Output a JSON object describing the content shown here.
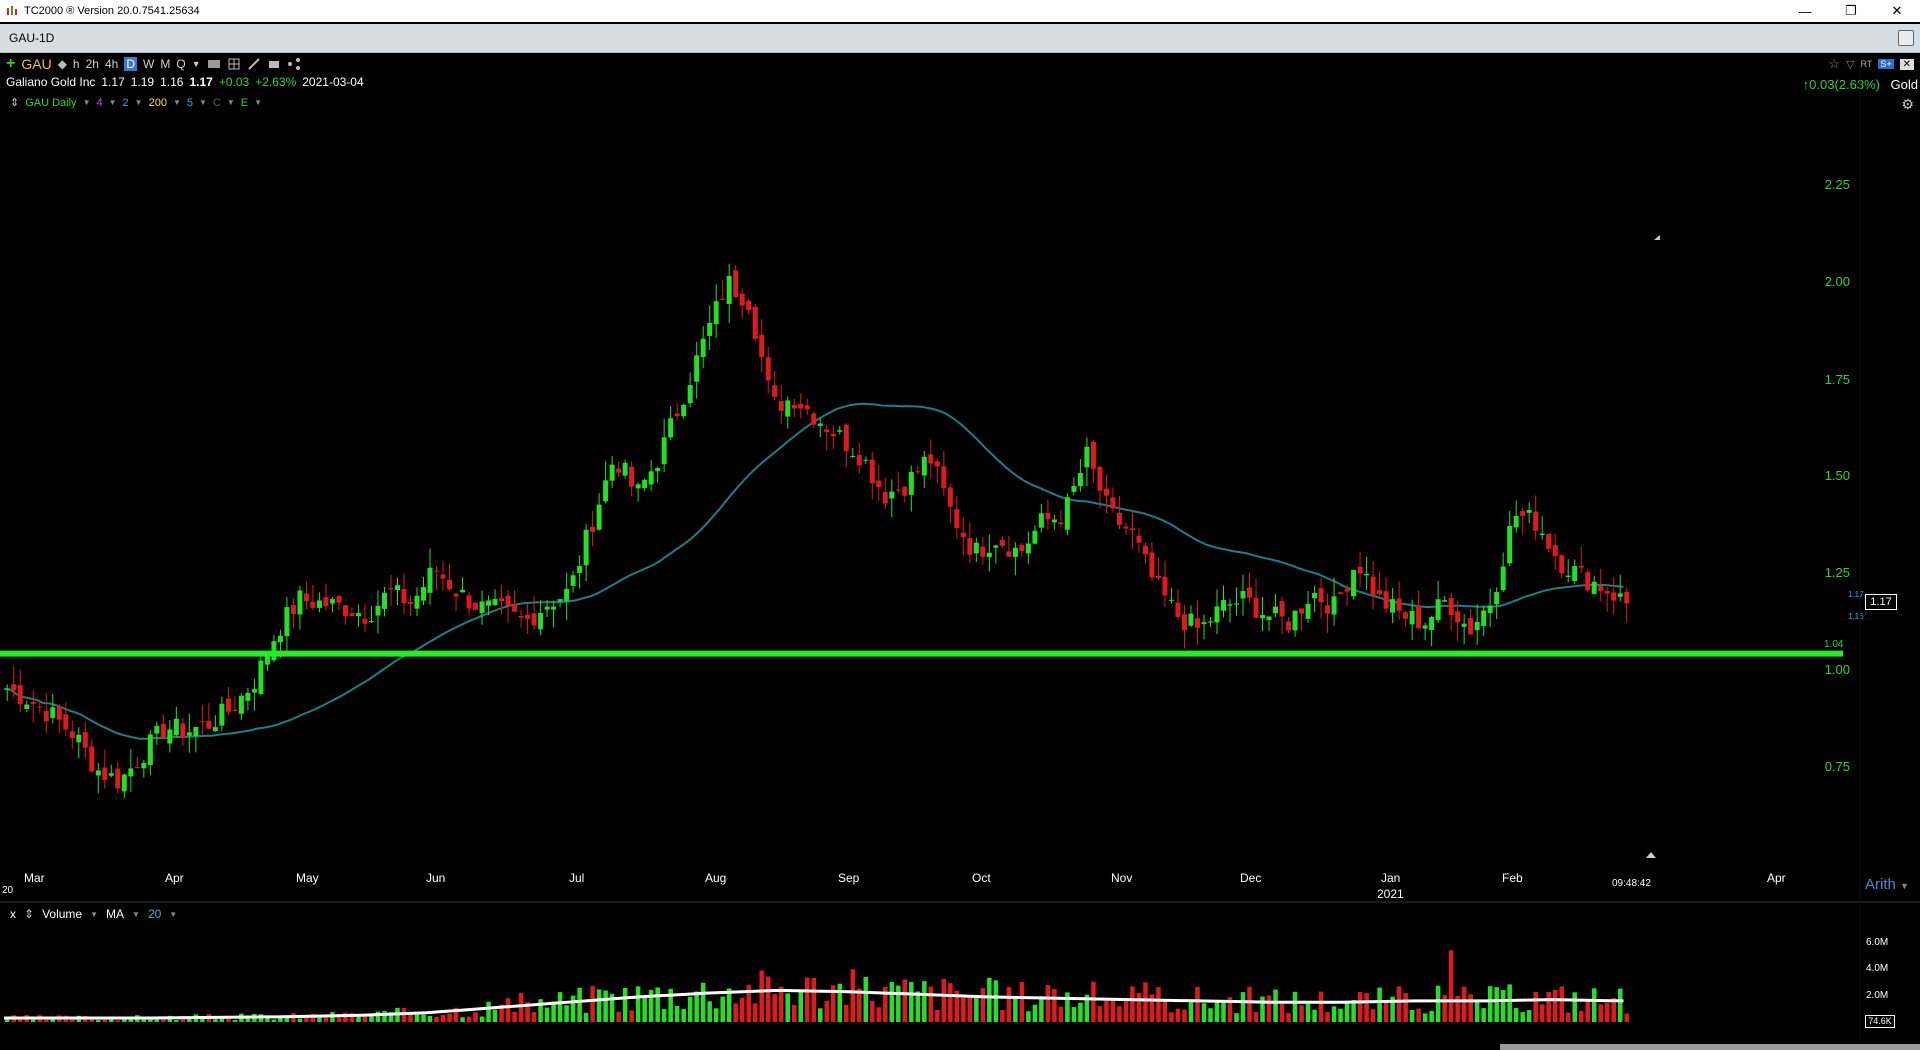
{
  "window": {
    "title": "TC2000 ® Version 20.0.7541.25634",
    "minimize": "—",
    "restore": "❐",
    "close": "✕"
  },
  "tab": {
    "label": "GAU-1D"
  },
  "toolbar": {
    "symbol": "GAU",
    "timeframes": [
      "h",
      "2h",
      "4h",
      "D",
      "W",
      "M",
      "Q"
    ],
    "active_timeframe": "D"
  },
  "quote": {
    "name": "Galiano Gold Inc",
    "open": "1.17",
    "high": "1.19",
    "low": "1.16",
    "close": "1.17",
    "change": "+0.03",
    "change_pct": "+2.63%",
    "date": "2021-03-04"
  },
  "study_line": {
    "label": "GAU Daily",
    "p1": "4",
    "p2": "2",
    "p3": "200",
    "p4": "5",
    "p5": "C",
    "p6": "E"
  },
  "right_info": {
    "change": "0.03(2.63%)",
    "sector": "Gold"
  },
  "price_axis": {
    "ticks": [
      "2.25",
      "2.00",
      "1.75",
      "1.50",
      "1.25",
      "1.00",
      "0.75"
    ],
    "last_price": "1.17",
    "high_label": "1.17",
    "low_label": "1.16",
    "line_label": "1.04",
    "scale_mode": "Arith",
    "time": "09:48:42"
  },
  "time_axis": {
    "months": [
      "Mar",
      "Apr",
      "May",
      "Jun",
      "Jul",
      "Aug",
      "Sep",
      "Oct",
      "Nov",
      "Dec",
      "Jan",
      "Feb",
      "Apr"
    ],
    "year": "2021",
    "left_fragment": "20"
  },
  "volume_panel": {
    "close_x": "x",
    "label": "Volume",
    "ma_label": "MA",
    "ma_period": "20",
    "ticks": [
      "6.0M",
      "4.0M",
      "2.0M"
    ],
    "last_volume": "74.6K"
  },
  "colors": {
    "up": "#22e022",
    "down": "#e01a1a",
    "ma": "#1f7f86",
    "support": "#22ee22",
    "volume_ma": "#ffffff"
  },
  "chart_data": {
    "type": "candlestick",
    "symbol": "GAU",
    "ylim": [
      0.55,
      2.35
    ],
    "support_level": 1.04,
    "x_months": [
      "Mar",
      "Apr",
      "May",
      "Jun",
      "Jul",
      "Aug",
      "Sep",
      "Oct",
      "Nov",
      "Dec",
      "Jan",
      "Feb",
      "Mar"
    ],
    "close_path": [
      0.95,
      0.92,
      0.88,
      0.83,
      0.74,
      0.71,
      0.78,
      0.85,
      0.84,
      0.86,
      0.9,
      0.97,
      1.1,
      1.18,
      1.17,
      1.16,
      1.14,
      1.2,
      1.17,
      1.26,
      1.2,
      1.16,
      1.15,
      1.12,
      1.17,
      1.2,
      1.38,
      1.55,
      1.45,
      1.55,
      1.7,
      1.85,
      2.0,
      1.95,
      1.68,
      1.7,
      1.65,
      1.6,
      1.55,
      1.45,
      1.48,
      1.55,
      1.4,
      1.3,
      1.34,
      1.3,
      1.38,
      1.4,
      1.55,
      1.4,
      1.35,
      1.22,
      1.14,
      1.1,
      1.16,
      1.18,
      1.14,
      1.12,
      1.2,
      1.16,
      1.28,
      1.18,
      1.14,
      1.12,
      1.18,
      1.1,
      1.18,
      1.4,
      1.38,
      1.28,
      1.24,
      1.21,
      1.17
    ],
    "volume_ma_path_m": [
      0.3,
      0.3,
      0.3,
      0.35,
      0.4,
      0.5,
      0.7,
      1.1,
      1.5,
      1.9,
      2.2,
      2.4,
      2.3,
      2.1,
      1.9,
      1.8,
      1.7,
      1.6,
      1.5,
      1.5,
      1.6,
      1.6,
      1.7,
      1.6
    ]
  }
}
